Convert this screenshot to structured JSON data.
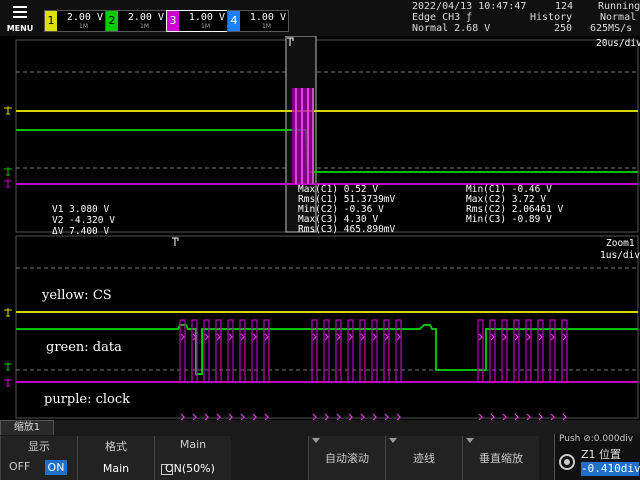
{
  "menu": {
    "label": "MENU"
  },
  "channels": [
    {
      "num": "1",
      "scale": "2.00 V",
      "coupling": "1M"
    },
    {
      "num": "2",
      "scale": "2.00 V",
      "coupling": "1M"
    },
    {
      "num": "3",
      "scale": "1.00 V",
      "coupling": "1M"
    },
    {
      "num": "4",
      "scale": "1.00 V",
      "coupling": "1M"
    }
  ],
  "header": {
    "datetime": "2022/04/13 10:47:47",
    "acq_count": "124",
    "run_status": "Running",
    "trigger_line": "Edge CH3 ƒ",
    "trigger_mode": "Normal 2.68 V",
    "history_label": "History",
    "history_value": "250",
    "acq_mode": "Normal",
    "sample_rate": "625MS/s"
  },
  "main_window": {
    "timebase": "20us/div",
    "cursors": {
      "v1": "V1  3.080 V",
      "v2": "V2 -4.320 V",
      "dv": "ΔV  7.400 V"
    },
    "measurements_left": [
      "Max(C1)  0.52 V",
      "Rms(C1)  51.3739mV",
      "Min(C2) -0.36 V",
      "Max(C3)  4.30 V",
      "Rms(C3)  465.890mV"
    ],
    "measurements_right": [
      "Min(C1) -0.46 V",
      "Max(C2)  3.72 V",
      "Rms(C2)  2.06461 V",
      "Min(C3) -0.89 V"
    ]
  },
  "zoom_window": {
    "label": "Zoom1",
    "timebase": "1us/div",
    "annotations": {
      "cs": "yellow: CS",
      "data": "green: data",
      "clock": "purple: clock"
    }
  },
  "softkeys": {
    "zoom_tab": "缩放1",
    "display": {
      "title": "显示",
      "off": "OFF",
      "on": "ON"
    },
    "format": {
      "title": "格式",
      "value": "Main"
    },
    "main": {
      "title": "Main",
      "value": "ON(50%)"
    },
    "auto_scroll": {
      "title": "自动滚动"
    },
    "trace": {
      "title": "迹线"
    },
    "vertical_zoom": {
      "title": "垂直缩放"
    },
    "position": {
      "push": "Push ⊘:0.000div",
      "label": "Z1 位置",
      "value": "-0.410div"
    }
  },
  "colors": {
    "ch1": "#e0e000",
    "ch2": "#00cc00",
    "ch3": "#d000d0",
    "ch4": "#2080ff",
    "accent": "#1e70c8"
  }
}
